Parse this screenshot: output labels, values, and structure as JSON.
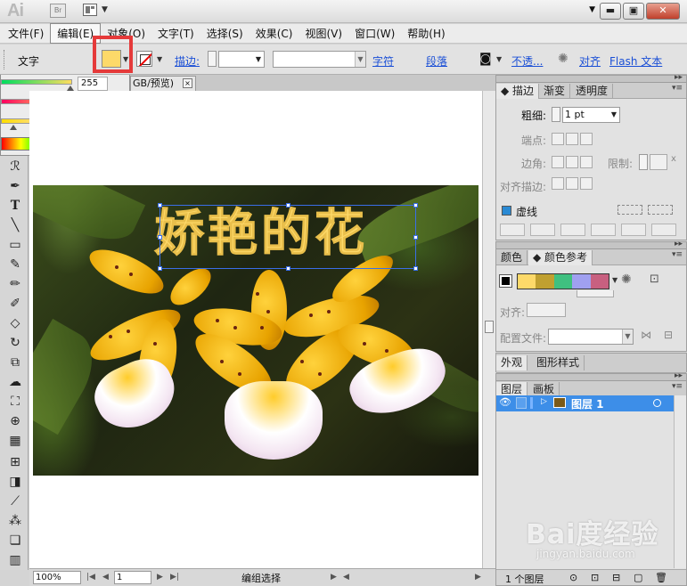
{
  "titlebar": {
    "app_logo": "Ai",
    "bridge_label": "Br"
  },
  "menu": [
    "文件(F)",
    "编辑(E)",
    "对象(O)",
    "文字(T)",
    "选择(S)",
    "效果(C)",
    "视图(V)",
    "窗口(W)",
    "帮助(H)"
  ],
  "control": {
    "type_label": "文字",
    "stroke_label": "描边:",
    "char_link": "字符",
    "para_link": "段落",
    "opacity_link": "不透...",
    "align_link": "对齐",
    "flash_link": "Flash 文本"
  },
  "colors": {
    "fill": "#fdd969",
    "r": "255",
    "g": "221",
    "b": "95"
  },
  "doc": {
    "tab_title": "GB/预览)",
    "close_glyph": "×",
    "artwork_text": "娇艳的花"
  },
  "status": {
    "zoom": "100%",
    "page": "1",
    "mode": "编组选择"
  },
  "stroke_panel": {
    "tabs": [
      "描边",
      "渐变",
      "透明度"
    ],
    "weight_label": "粗细:",
    "weight_value": "1 pt",
    "cap_label": "端点:",
    "corner_label": "边角:",
    "limit_label": "限制:",
    "limit_unit": "x",
    "align_label": "对齐描边:",
    "dashed_label": "虚线"
  },
  "color_panel": {
    "tabs": [
      "颜色",
      "颜色参考"
    ],
    "swatches": [
      "#fdd969",
      "#c0a030",
      "#40c080",
      "#a0a0f0",
      "#c86080"
    ],
    "align_label": "对齐:",
    "profile_label": "配置文件:"
  },
  "appearance_panel": {
    "tabs": [
      "外观",
      "图形样式"
    ]
  },
  "layers_panel": {
    "tabs": [
      "图层",
      "画板"
    ],
    "layer_name": "图层 1",
    "footer_count": "1 个图层"
  },
  "watermark": {
    "brand": "Bai度经验",
    "url": "jingyan.baidu.com"
  }
}
